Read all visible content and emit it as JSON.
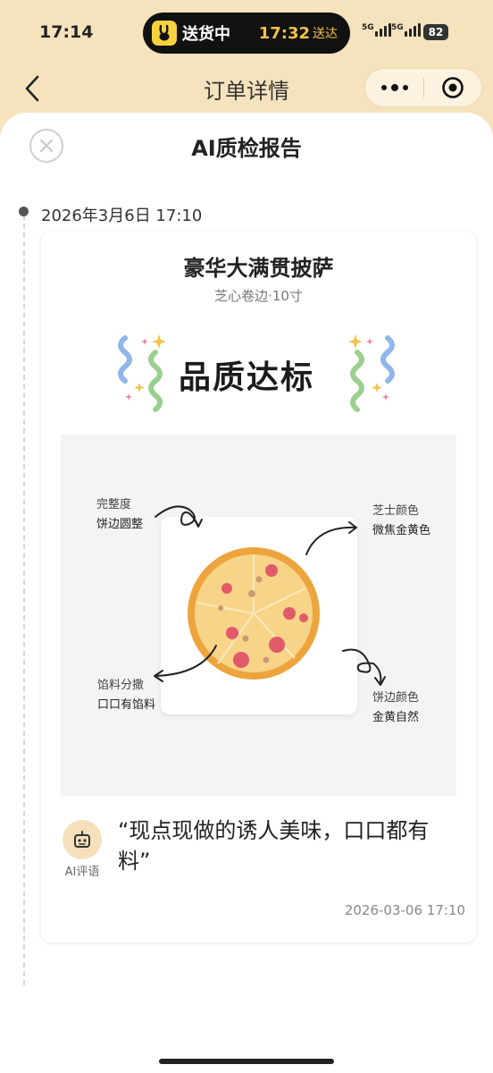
{
  "status_bar": {
    "time": "17:14",
    "delivery_status": "送货中",
    "eta_time": "17:32",
    "eta_label": "送达",
    "network_1": "5G",
    "network_2": "5G",
    "battery": "82",
    "brand_color": "#f7d23e"
  },
  "nav": {
    "title": "订单详情",
    "back_icon": "chevron-left-icon",
    "more_icon": "more-dots-icon",
    "target_icon": "target-icon"
  },
  "sheet": {
    "title": "AI质检报告",
    "close_icon": "close-icon"
  },
  "timeline": {
    "date": "2026年3月6日 17:10"
  },
  "report": {
    "product_name": "豪华大满贯披萨",
    "product_spec": "芝心卷边·10寸",
    "result": "品质达标",
    "annotations": {
      "integrity": {
        "label": "完整度",
        "value": "饼边圆整"
      },
      "cheese_color": {
        "label": "芝士颜色",
        "value": "微焦金黄色"
      },
      "topping": {
        "label": "馅料分撒",
        "value": "口口有馅料"
      },
      "crust_color": {
        "label": "饼边颜色",
        "value": "金黄自然"
      }
    },
    "ai_label": "AI评语",
    "ai_comment": "“现点现做的诱人美味，口口都有料”",
    "timestamp": "2026-03-06 17:10",
    "accent_color": "#f5e0bb"
  }
}
